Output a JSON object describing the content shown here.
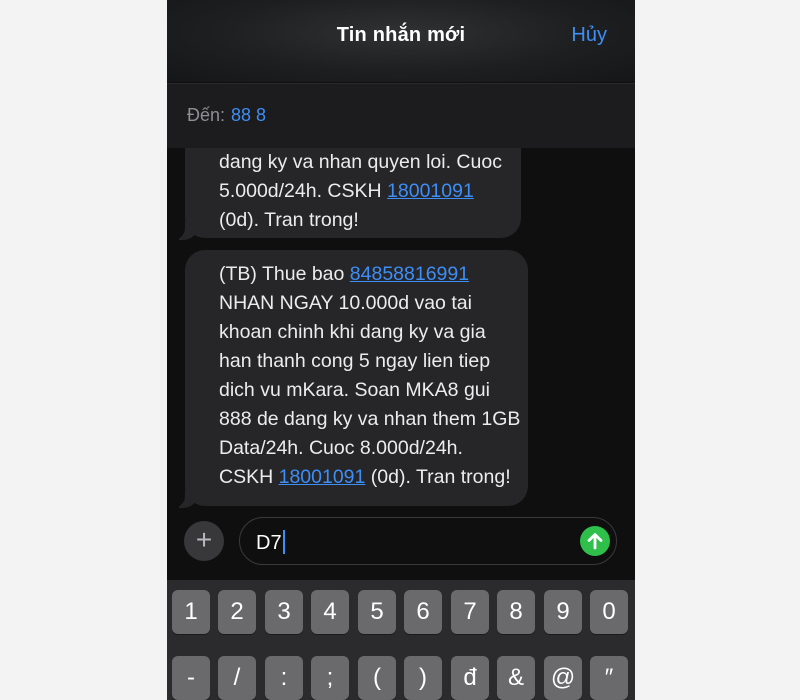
{
  "header": {
    "title": "Tin nhắn mới",
    "cancel_label": "Hủy"
  },
  "to": {
    "label": "Đến:",
    "value": "88 8"
  },
  "messages": {
    "bubble1": {
      "line1": "dang ky va nhan quyen loi. Cuoc",
      "line2_prefix": "5.000d/24h. CSKH ",
      "line2_link": "18001091",
      "line3": "(0d). Tran trong!"
    },
    "bubble2": {
      "line1_prefix": "(TB) Thue bao ",
      "line1_link": "84858816991",
      "line2": "NHAN NGAY 10.000d vao tai",
      "line3": "khoan chinh khi dang ky va gia",
      "line4": "han thanh cong 5 ngay lien tiep",
      "line5": "dich vu mKara. Soan MKA8 gui",
      "line6": "888 de dang ky va nhan them 1GB",
      "line7": "Data/24h. Cuoc 8.000d/24h.",
      "line8_prefix": "CSKH ",
      "line8_link": "18001091",
      "line8_suffix": " (0d). Tran trong!"
    }
  },
  "compose": {
    "plus_icon": "+",
    "input_value": "D7",
    "send_icon": "arrow-up-icon",
    "send_color": "#2fbf4b"
  },
  "keyboard": {
    "row1": [
      "1",
      "2",
      "3",
      "4",
      "5",
      "6",
      "7",
      "8",
      "9",
      "0"
    ],
    "row2": [
      "-",
      "/",
      ":",
      ";",
      "(",
      ")",
      "đ",
      "&",
      "@",
      "″"
    ]
  },
  "colors": {
    "accent": "#3d8ef7",
    "bubble": "#262628",
    "background": "#0f0f10"
  }
}
